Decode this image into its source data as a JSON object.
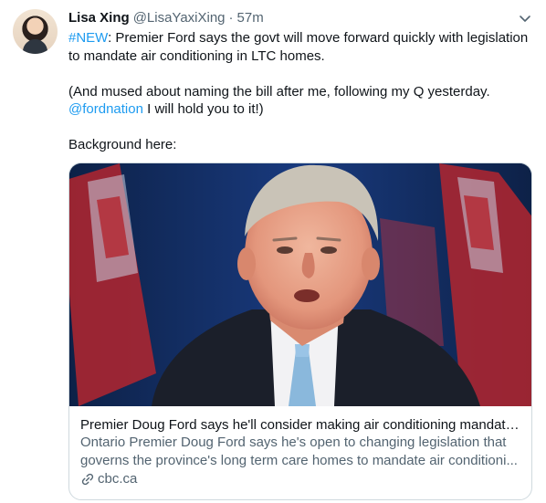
{
  "tweet": {
    "author": {
      "name": "Lisa Xing",
      "handle": "@LisaYaxiXing",
      "separator": "·",
      "time": "57m"
    },
    "text": {
      "p1_hashtag": "#NEW",
      "p1_rest": ": Premier Ford says the govt will move forward quickly with legislation to mandate air conditioning in LTC homes.",
      "p2_start": "(And mused about naming the bill after me, following my Q yesterday.",
      "p2_mention": "@fordnation",
      "p2_end": " I will hold you to it!)",
      "p3": "Background here:"
    },
    "card": {
      "title": "Premier Doug Ford says he'll consider making air conditioning mandato...",
      "description_line1": "Ontario Premier Doug Ford says he's open to changing legislation that",
      "description_line2": "governs the province's long term care homes to mandate air conditioni...",
      "domain": "cbc.ca",
      "image_icon": "person-photo-with-flags"
    }
  },
  "colors": {
    "text": "#0f1419",
    "secondary": "#536471",
    "link": "#1d9bf0",
    "border": "#cfd9de"
  },
  "icons": {
    "menu": "chevron-down-icon",
    "card_link": "link-icon"
  }
}
